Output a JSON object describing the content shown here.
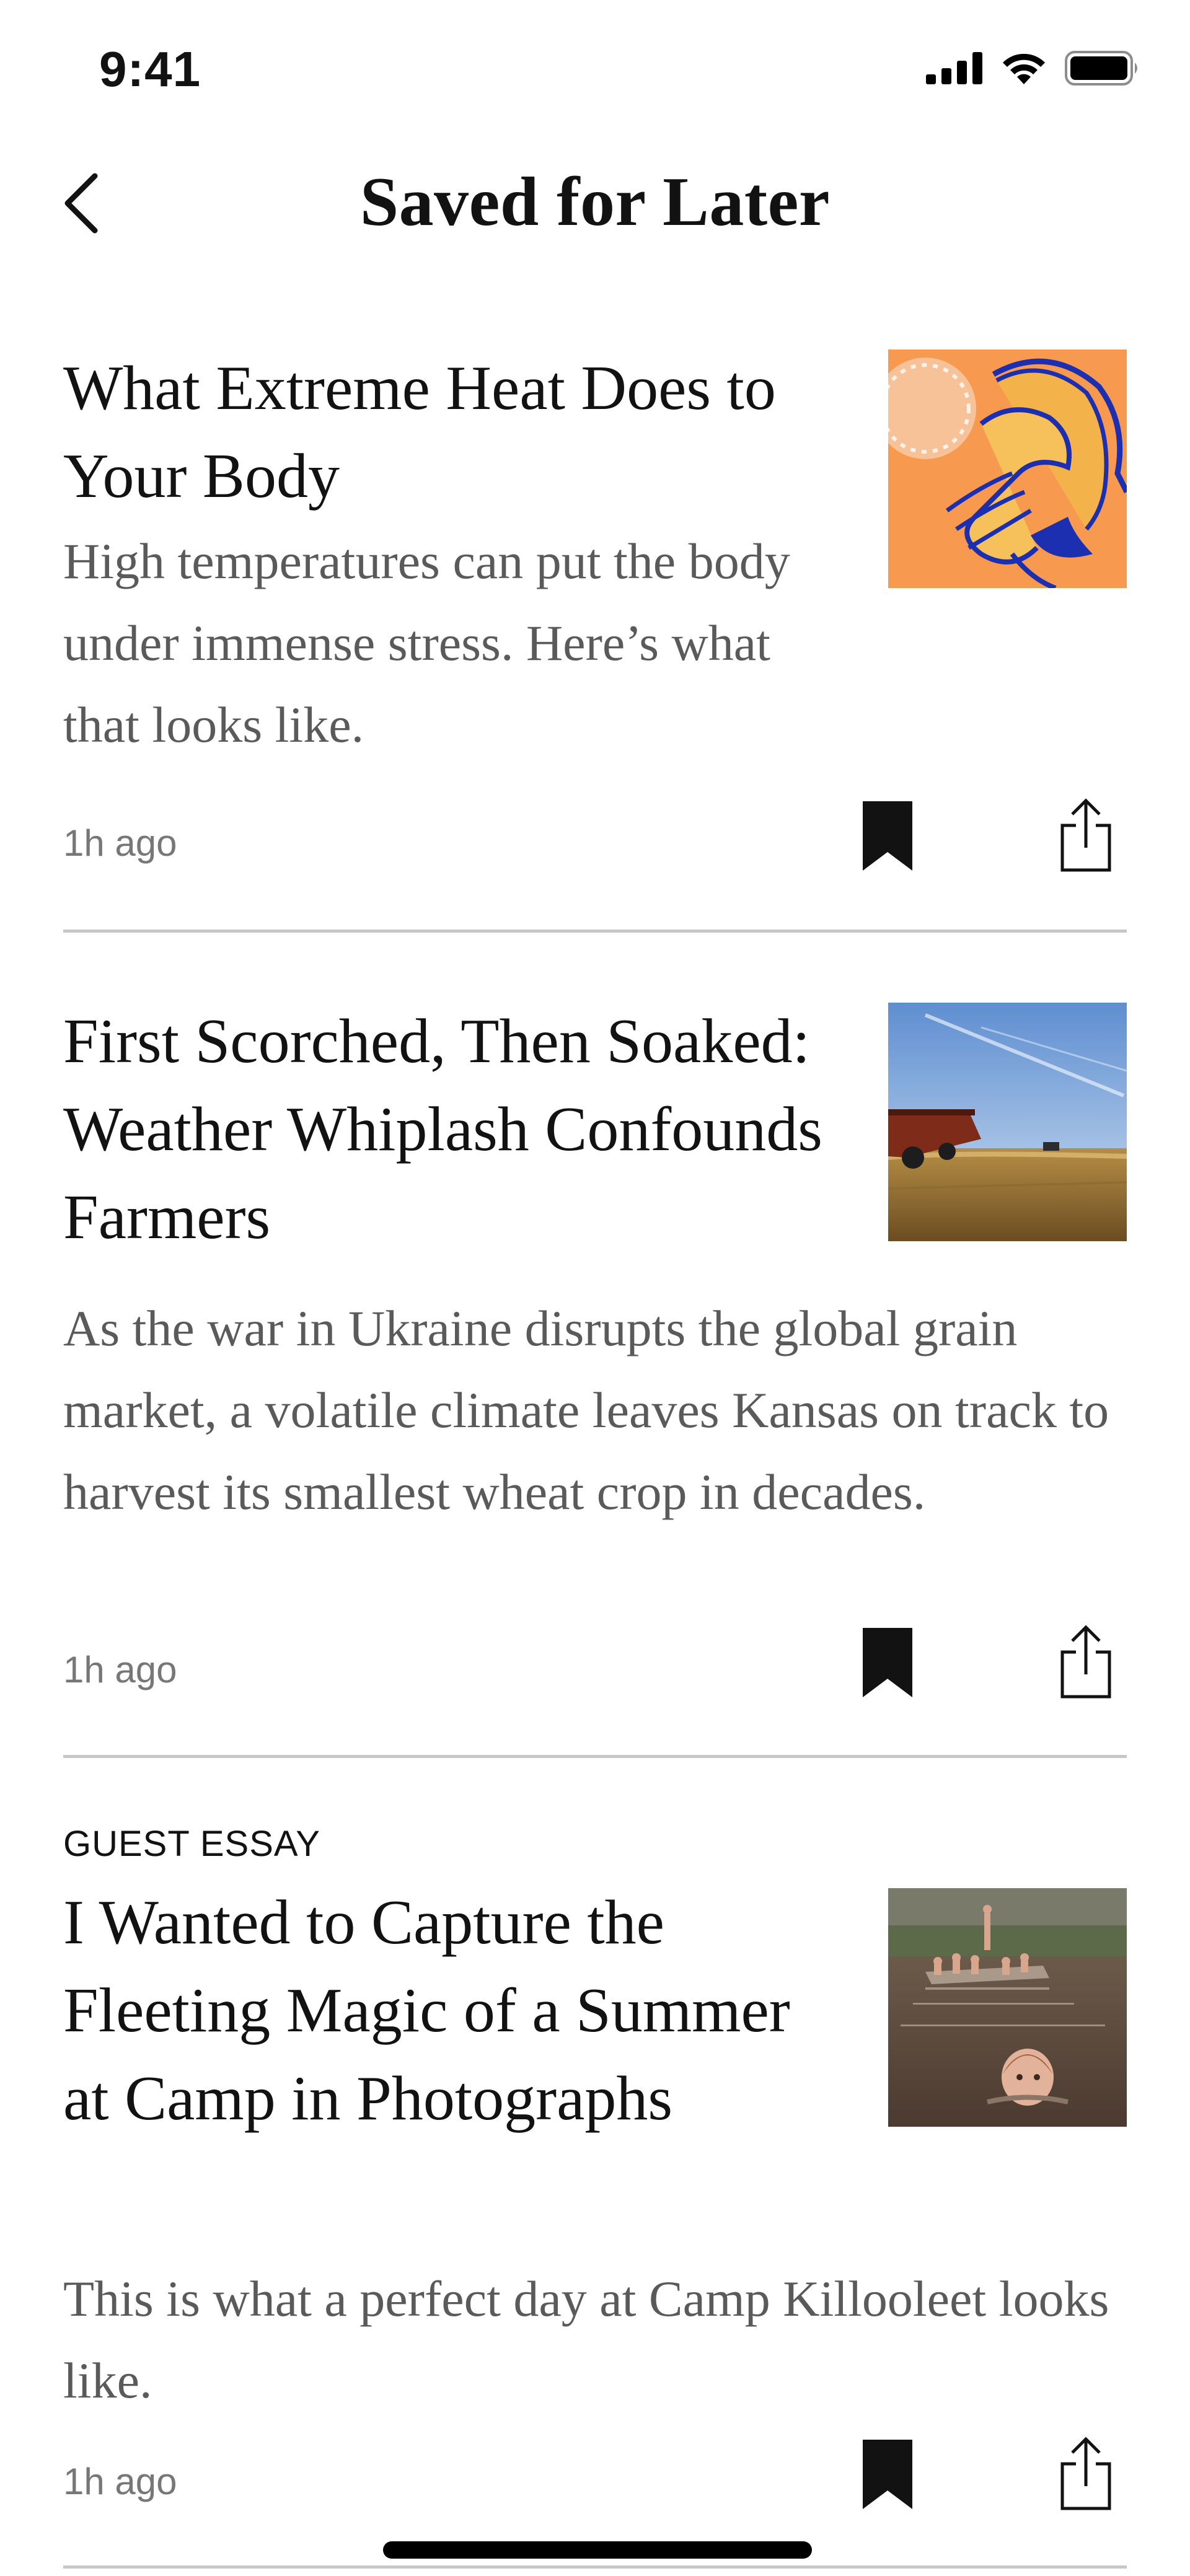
{
  "status_bar": {
    "time": "9:41"
  },
  "nav": {
    "title": "Saved for Later",
    "back_icon": "chevron-left-icon"
  },
  "articles": [
    {
      "kicker": "",
      "headline": "What Extreme Heat Does to Your Body",
      "summary": "High temperatures can put the body under immense stress. Here’s what that looks like.",
      "timestamp": "1h ago",
      "thumbnail": "illustration of a person shielding face from a sun"
    },
    {
      "kicker": "",
      "headline": "First Scorched, Then Soaked: Weather Whiplash Confounds Farmers",
      "summary": "As the war in Ukraine disrupts the global grain market, a volatile climate leaves Kansas on track to harvest its smallest wheat crop in decades.",
      "timestamp": "1h ago",
      "thumbnail": "wheat field with grain cart and tractor under blue sky"
    },
    {
      "kicker": "GUEST ESSAY",
      "headline": "I Wanted to Capture the Fleeting Magic of a Summer at Camp in Photographs",
      "summary": "This is what a perfect day at Camp Killooleet looks like.",
      "timestamp": "1h ago",
      "thumbnail": "children swimming in a lake near a raft"
    }
  ],
  "colors": {
    "text": "#121212",
    "summary": "#5a5a5a",
    "timestamp": "#777777",
    "divider": "#c7c7c7",
    "heat_thumb_bg": "#f79a4f",
    "heat_thumb_ink": "#1b2fb0"
  }
}
